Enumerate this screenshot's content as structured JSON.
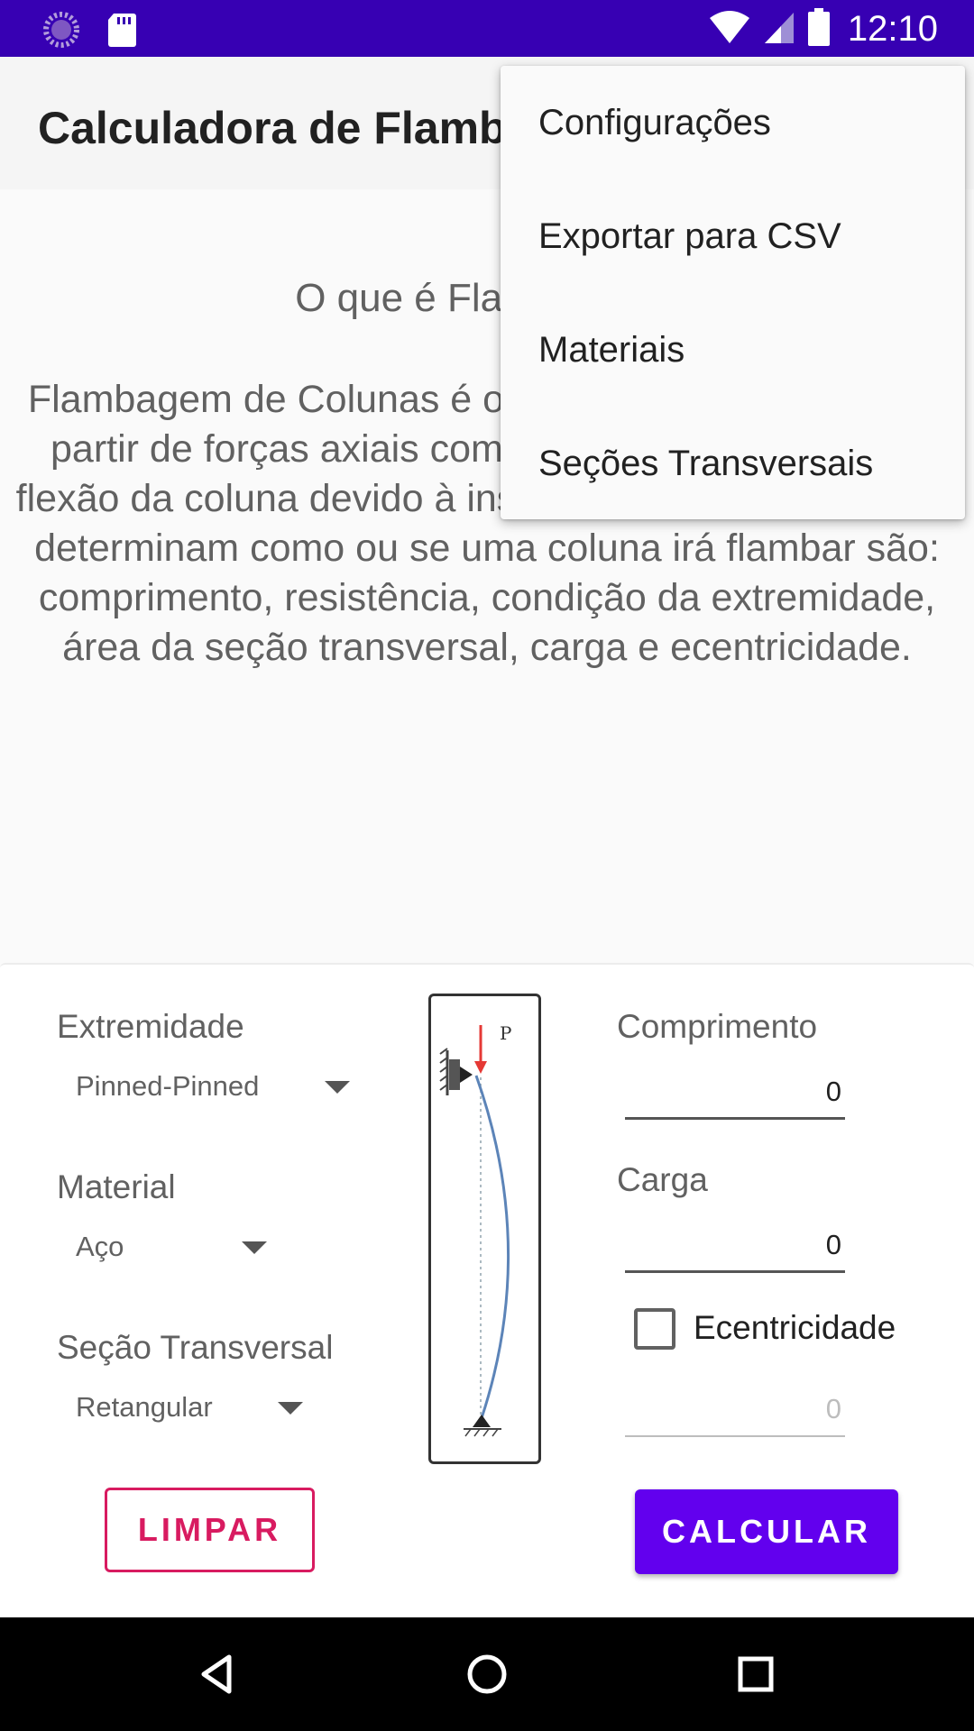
{
  "status_bar": {
    "time": "12:10",
    "icons": [
      "loading-circle-icon",
      "sd-card-icon",
      "wifi-icon",
      "cell-signal-icon",
      "battery-icon"
    ]
  },
  "app_bar": {
    "title": "Calculadora de Flambagem"
  },
  "intro": {
    "heading": "O que é Flambagem?",
    "body": "Flambagem de Colunas é o colapso de uma coluna a partir de forças axiais compressivas, resultando na flexão da coluna devido à instabilidade. Os fatores que determinam como ou se uma coluna irá flambar são: comprimento, resistência, condição da extremidade, área da seção transversal, carga e ecentricidade."
  },
  "form": {
    "end_condition": {
      "label": "Extremidade",
      "value": "Pinned-Pinned"
    },
    "material": {
      "label": "Material",
      "value": "Aço"
    },
    "cross_section": {
      "label": "Seção Transversal",
      "value": "Retangular"
    },
    "length": {
      "label": "Comprimento",
      "value": "0"
    },
    "load": {
      "label": "Carga",
      "value": "0"
    },
    "eccentricity": {
      "label": "Ecentricidade",
      "checked": false,
      "value": "0"
    },
    "figure_label": "P"
  },
  "buttons": {
    "clear": "LIMPAR",
    "calculate": "CALCULAR"
  },
  "menu": {
    "items": [
      "Configurações",
      "Exportar para CSV",
      "Materiais",
      "Seções Transversais"
    ]
  },
  "colors": {
    "status_bar": "#3700b3",
    "primary": "#6200ee",
    "accent": "#d81b60"
  }
}
